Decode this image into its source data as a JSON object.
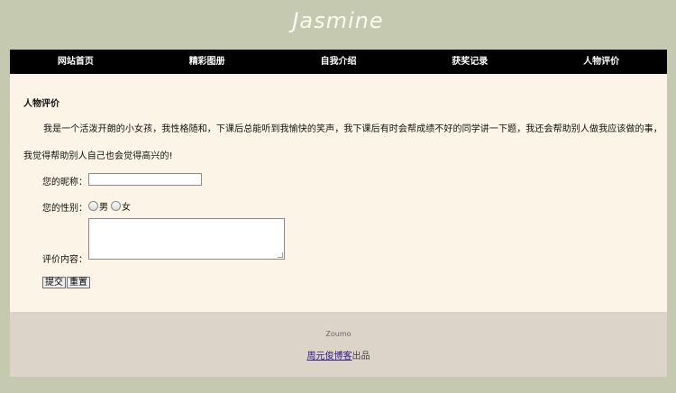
{
  "site": {
    "title": "Jasmine"
  },
  "nav": {
    "items": [
      {
        "label": "网站首页"
      },
      {
        "label": "精彩图册"
      },
      {
        "label": "自我介绍"
      },
      {
        "label": "获奖记录"
      },
      {
        "label": "人物评价"
      }
    ]
  },
  "main": {
    "heading": "人物评价",
    "intro": "我是一个活泼开朗的小女孩，我性格随和，下课后总能听到我愉快的笑声，我下课后有时会帮成绩不好的同学讲一下题，我还会帮助别人做我应该做的事，我觉得帮助别人自己也会觉得高兴的!"
  },
  "form": {
    "nickname_label": "您的昵称：",
    "nickname_value": "",
    "gender_label": "您的性别：",
    "gender_options": [
      {
        "label": "男",
        "checked": false
      },
      {
        "label": "女",
        "checked": false
      }
    ],
    "comment_label": "评价内容：",
    "comment_value": "",
    "submit_label": "提交",
    "reset_label": "重置"
  },
  "footer": {
    "credit": "Zoumo",
    "link_text": "周元俊博客",
    "suffix": "出品"
  }
}
